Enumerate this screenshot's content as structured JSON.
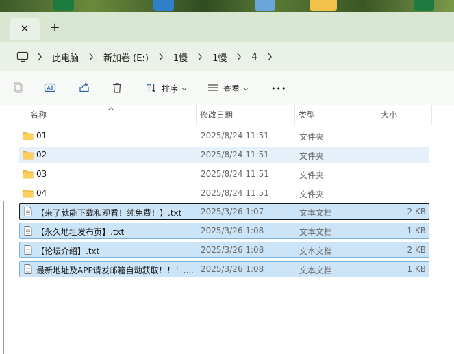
{
  "window": {
    "tab_close_glyph": "✕",
    "tab_add_glyph": "+"
  },
  "breadcrumb": {
    "items": [
      "此电脑",
      "新加卷 (E:)",
      "1慢",
      "1慢",
      "4"
    ]
  },
  "toolbar": {
    "sort_label": "排序",
    "view_label": "查看",
    "more_label": "•••"
  },
  "columns": {
    "name": "名称",
    "date": "修改日期",
    "type": "类型",
    "size": "大小"
  },
  "files": [
    {
      "name": "01",
      "date": "2025/8/24 11:51",
      "type": "文件夹",
      "size": "",
      "icon": "folder-icon"
    },
    {
      "name": "02",
      "date": "2025/8/24 11:51",
      "type": "文件夹",
      "size": "",
      "icon": "folder-icon"
    },
    {
      "name": "03",
      "date": "2025/8/24 11:51",
      "type": "文件夹",
      "size": "",
      "icon": "folder-icon"
    },
    {
      "name": "04",
      "date": "2025/8/24 11:51",
      "type": "文件夹",
      "size": "",
      "icon": "folder-icon"
    },
    {
      "name": "【来了就能下载和观看！纯免费！】.txt",
      "date": "2025/3/26 1:07",
      "type": "文本文档",
      "size": "2 KB",
      "icon": "text-file-icon"
    },
    {
      "name": "【永久地址发布页】.txt",
      "date": "2025/3/26 1:08",
      "type": "文本文档",
      "size": "1 KB",
      "icon": "text-file-icon"
    },
    {
      "name": "【论坛介绍】.txt",
      "date": "2025/3/26 1:08",
      "type": "文本文档",
      "size": "2 KB",
      "icon": "text-file-icon"
    },
    {
      "name": "最新地址及APP请发邮箱自动获取！！！....",
      "date": "2025/3/26 1:08",
      "type": "文本文档",
      "size": "1 KB",
      "icon": "text-file-icon"
    }
  ],
  "colors": {
    "selection": "#cce4f7",
    "selection_border": "#7ab0de",
    "hover": "#e6f0fa",
    "folder": "#f5c242"
  }
}
